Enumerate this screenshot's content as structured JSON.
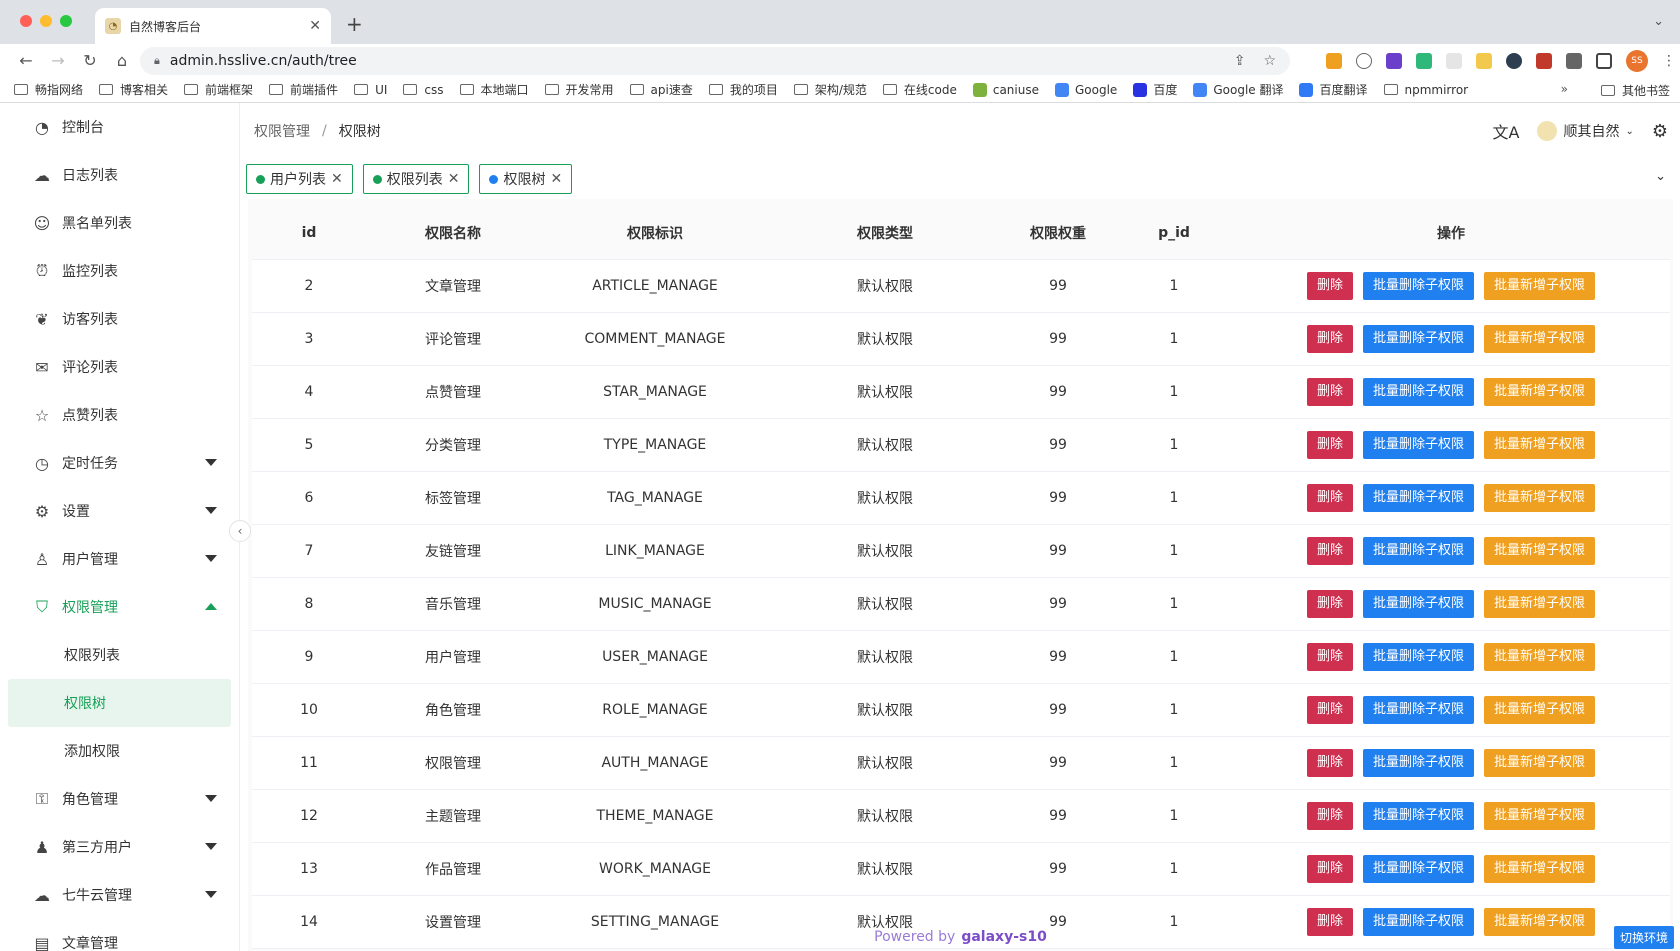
{
  "browser": {
    "tab_title": "自然博客后台",
    "url": "admin.hsslive.cn/auth/tree",
    "avatar_text": "SS",
    "bookmarks": [
      "畅指网络",
      "博客相关",
      "前端框架",
      "前端插件",
      "UI",
      "css",
      "本地端口",
      "开发常用",
      "api速查",
      "我的项目",
      "架构/规范",
      "在线code",
      "caniuse",
      "Google",
      "百度",
      "Google 翻译",
      "百度翻译",
      "npmmirror"
    ],
    "bookmarks_more": "»",
    "other_bookmarks": "其他书签"
  },
  "sidebar": {
    "items": [
      {
        "label": "控制台",
        "icon": "dashboard-icon"
      },
      {
        "label": "日志列表",
        "icon": "cloud-icon"
      },
      {
        "label": "黑名单列表",
        "icon": "person-icon"
      },
      {
        "label": "监控列表",
        "icon": "alarm-icon"
      },
      {
        "label": "访客列表",
        "icon": "footprint-icon"
      },
      {
        "label": "评论列表",
        "icon": "comment-icon"
      },
      {
        "label": "点赞列表",
        "icon": "star-icon"
      },
      {
        "label": "定时任务",
        "icon": "clock-icon"
      },
      {
        "label": "设置",
        "icon": "gear-icon"
      },
      {
        "label": "用户管理",
        "icon": "user-icon"
      },
      {
        "label": "权限管理",
        "icon": "shield-icon"
      },
      {
        "label": "权限列表"
      },
      {
        "label": "权限树"
      },
      {
        "label": "添加权限"
      },
      {
        "label": "角色管理",
        "icon": "lock-icon"
      },
      {
        "label": "第三方用户",
        "icon": "users-icon"
      },
      {
        "label": "七牛云管理",
        "icon": "cloud-upload-icon"
      },
      {
        "label": "文章管理",
        "icon": "article-icon"
      }
    ]
  },
  "header": {
    "breadcrumb_parent": "权限管理",
    "breadcrumb_sep": "/",
    "breadcrumb_current": "权限树",
    "username": "顺其自然"
  },
  "tags": [
    "用户列表",
    "权限列表",
    "权限树"
  ],
  "table": {
    "columns": [
      "id",
      "权限名称",
      "权限标识",
      "权限类型",
      "权限权重",
      "p_id",
      "操作"
    ],
    "actions": [
      "删除",
      "批量删除子权限",
      "批量新增子权限"
    ],
    "rows": [
      [
        "2",
        "文章管理",
        "ARTICLE_MANAGE",
        "默认权限",
        "99",
        "1"
      ],
      [
        "3",
        "评论管理",
        "COMMENT_MANAGE",
        "默认权限",
        "99",
        "1"
      ],
      [
        "4",
        "点赞管理",
        "STAR_MANAGE",
        "默认权限",
        "99",
        "1"
      ],
      [
        "5",
        "分类管理",
        "TYPE_MANAGE",
        "默认权限",
        "99",
        "1"
      ],
      [
        "6",
        "标签管理",
        "TAG_MANAGE",
        "默认权限",
        "99",
        "1"
      ],
      [
        "7",
        "友链管理",
        "LINK_MANAGE",
        "默认权限",
        "99",
        "1"
      ],
      [
        "8",
        "音乐管理",
        "MUSIC_MANAGE",
        "默认权限",
        "99",
        "1"
      ],
      [
        "9",
        "用户管理",
        "USER_MANAGE",
        "默认权限",
        "99",
        "1"
      ],
      [
        "10",
        "角色管理",
        "ROLE_MANAGE",
        "默认权限",
        "99",
        "1"
      ],
      [
        "11",
        "权限管理",
        "AUTH_MANAGE",
        "默认权限",
        "99",
        "1"
      ],
      [
        "12",
        "主题管理",
        "THEME_MANAGE",
        "默认权限",
        "99",
        "1"
      ],
      [
        "13",
        "作品管理",
        "WORK_MANAGE",
        "默认权限",
        "99",
        "1"
      ],
      [
        "14",
        "设置管理",
        "SETTING_MANAGE",
        "默认权限",
        "99",
        "1"
      ]
    ]
  },
  "footer": {
    "powered_by": "Powered by",
    "brand": "galaxy-s10"
  },
  "env_button": "切换环境",
  "colors": {
    "accent": "#18a058",
    "danger": "#d03050",
    "info": "#2080f0",
    "warning": "#f0a020"
  }
}
